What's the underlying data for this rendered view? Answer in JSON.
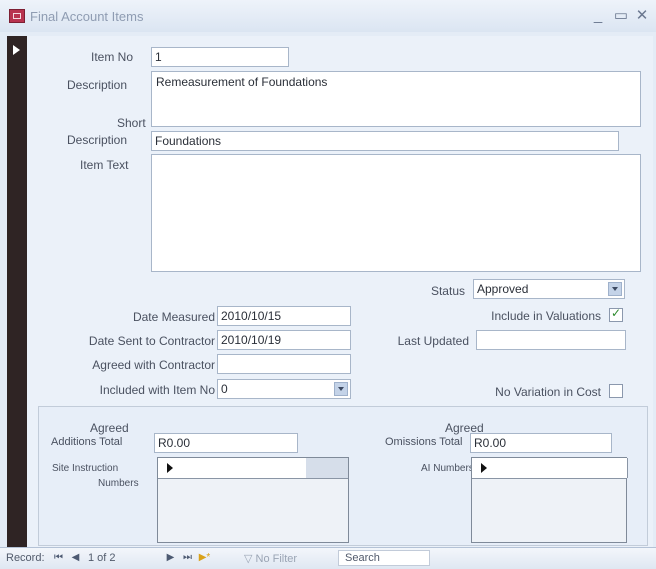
{
  "window": {
    "title": "Final Account Items"
  },
  "form": {
    "item_no": {
      "label": "Item No",
      "value": "1"
    },
    "description": {
      "label": "Description",
      "value": "Remeasurement of Foundations"
    },
    "short_description": {
      "label_line1": "Short",
      "label_line2": "Description",
      "value": "Foundations"
    },
    "item_text": {
      "label": "Item Text",
      "value": ""
    },
    "status": {
      "label": "Status",
      "value": "Approved"
    },
    "date_measured": {
      "label": "Date Measured",
      "value": "2010/10/15"
    },
    "include_in_valuations": {
      "label": "Include in Valuations",
      "checked": true
    },
    "date_sent": {
      "label": "Date Sent to Contractor",
      "value": "2010/10/19"
    },
    "last_updated": {
      "label": "Last Updated",
      "value": ""
    },
    "agreed_with_contractor": {
      "label": "Agreed with Contractor",
      "value": ""
    },
    "included_with_item_no": {
      "label": "Included with Item No",
      "value": "0"
    },
    "no_variation_in_cost": {
      "label": "No Variation in Cost",
      "checked": false
    }
  },
  "totals": {
    "additions": {
      "label_line1": "Agreed",
      "label_line2": "Additions Total",
      "value": "R0.00"
    },
    "omissions": {
      "label_line1": "Agreed",
      "label_line2": "Omissions Total",
      "value": "R0.00"
    }
  },
  "subforms": {
    "site_instruction": {
      "label_line1": "Site Instruction",
      "label_line2": "Numbers"
    },
    "ai_numbers": {
      "label": "AI Numbers"
    }
  },
  "statusbar": {
    "record_label": "Record:",
    "position": "1 of 2",
    "filter_label": "No Filter",
    "search_label": "Search"
  }
}
